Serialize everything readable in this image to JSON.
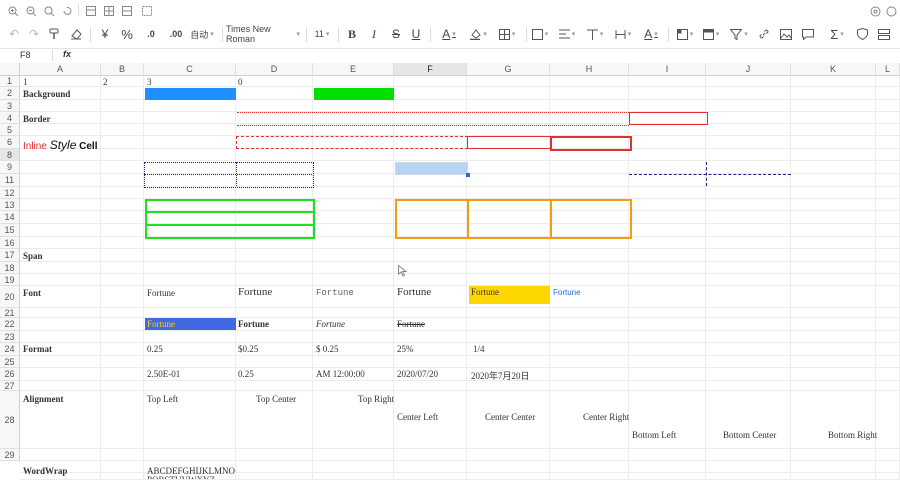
{
  "menu_icons": [
    "zoom-in-icon",
    "zoom-out-icon",
    "zoom-reset-icon",
    "rotate-icon",
    "freeze-icon",
    "grid-icon",
    "split-icon",
    "fit-icon"
  ],
  "toolbar": {
    "currency": "¥",
    "percent": "%",
    "decrease_decimal": ".0",
    "increase_decimal": ".00",
    "number_format": "自动",
    "font_family": "Times New Roman",
    "font_size": "11",
    "bold": "B",
    "italic": "I",
    "strike": "S",
    "underline": "U",
    "font_color": "A",
    "text_rotate": "A",
    "sum": "Σ"
  },
  "formula_bar": {
    "name_box": "F8",
    "fx": "fx"
  },
  "columns": [
    "A",
    "B",
    "C",
    "D",
    "E",
    "F",
    "G",
    "H",
    "I",
    "J",
    "K",
    "L"
  ],
  "selected_column": "F",
  "rows": [
    "1",
    "2",
    "3",
    "4",
    "5",
    "6",
    "8",
    "9",
    "11",
    "12",
    "13",
    "14",
    "15",
    "16",
    "17",
    "18",
    "19",
    "20",
    "21",
    "22",
    "23",
    "24",
    "25",
    "26",
    "27",
    "28",
    "29"
  ],
  "selected_row": "8",
  "colors": {
    "blue_fill": "#1e90ff",
    "green_fill": "#00e000",
    "gold_fill": "#ffd700",
    "royal_blue_fill": "#4169e1",
    "selection": "#b7d3f2",
    "orange_border": "#f39c12",
    "green_border": "#1fe01f",
    "red_border": "#e03030",
    "navy_dash": "#1a237e"
  },
  "cells": {
    "a1": "1",
    "b1": "2",
    "c1": "3",
    "d1": "0",
    "background": "Background",
    "border": "Border",
    "inline_style": {
      "part1": "Inline ",
      "part2": "Style",
      "part3": " Cell"
    },
    "span": "Span",
    "font": "Font",
    "fortune": "Fortune",
    "format": "Format",
    "c22": "0.25",
    "d22": "$0.25",
    "e22": "$ 0.25",
    "f22": "25%",
    "g22": "1/4",
    "c24": "2.50E-01",
    "d24": "0.25",
    "e24": "AM 12:00:00",
    "f24": "2020/07/20",
    "g24": "2020年7月20日",
    "alignment": "Alignment",
    "top_left": "Top Left",
    "top_center": "Top Center",
    "top_right": "Top Right",
    "center_left": "Center Left",
    "center_center": "Center Center",
    "center_right": "Center Right",
    "bottom_left": "Bottom Left",
    "bottom_center": "Bottom Center",
    "bottom_right": "Bottom Right",
    "wordwrap": "WordWrap",
    "wordwrap_text": "ABCDEFGHIJKLMNO",
    "wordwrap_text2": "PQRSTUVWXYZ"
  }
}
